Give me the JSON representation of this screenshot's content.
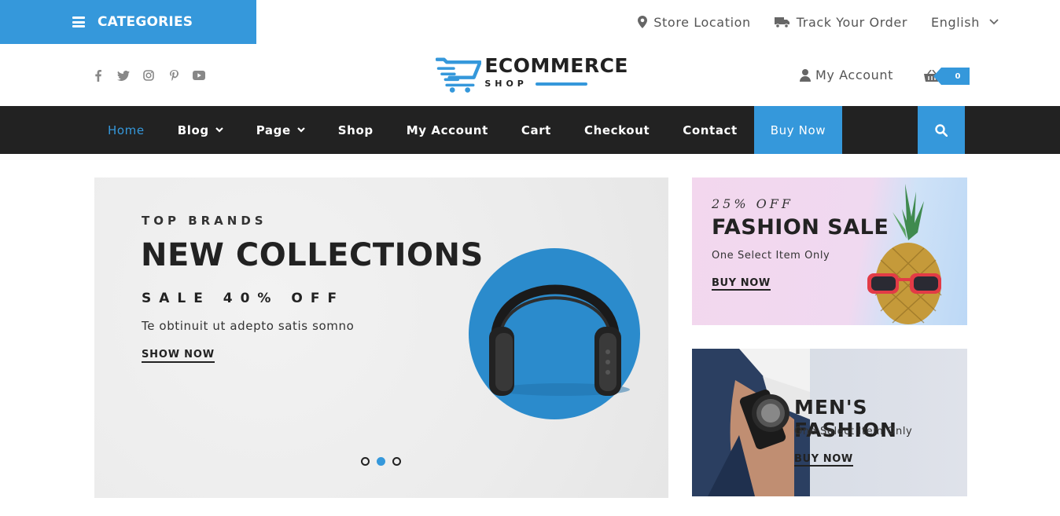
{
  "topbar": {
    "categories_label": "CATEGORIES",
    "store_location": "Store Location",
    "track_order": "Track Your Order",
    "language": "English"
  },
  "header": {
    "social_icons": [
      "facebook-icon",
      "twitter-icon",
      "instagram-icon",
      "pinterest-icon",
      "youtube-icon"
    ],
    "logo_title": "ECOMMERCE",
    "logo_sub": "SHOP",
    "account_label": "My Account",
    "cart_count": "0"
  },
  "nav": {
    "items": [
      {
        "label": "Home",
        "active": true
      },
      {
        "label": "Blog",
        "dropdown": true
      },
      {
        "label": "Page",
        "dropdown": true
      },
      {
        "label": "Shop"
      },
      {
        "label": "My Account"
      },
      {
        "label": "Cart"
      },
      {
        "label": "Checkout"
      },
      {
        "label": "Contact"
      }
    ],
    "buy_now": "Buy Now"
  },
  "hero": {
    "kicker": "TOP BRANDS",
    "title": "NEW COLLECTIONS",
    "sale": "SALE 40% OFF",
    "description": "Te obtinuit ut adepto satis somno",
    "link": "SHOW NOW",
    "slides": 3,
    "active_slide": 2
  },
  "banner1": {
    "kicker": "25% OFF",
    "title": "FASHION SALE",
    "subtitle": "One Select Item Only",
    "link": "BUY NOW"
  },
  "banner2": {
    "title": "MEN'S FASHION",
    "subtitle": "One Select Item Only",
    "link": "BUY NOW"
  },
  "colors": {
    "accent": "#3598db",
    "nav_bg": "#222222"
  }
}
